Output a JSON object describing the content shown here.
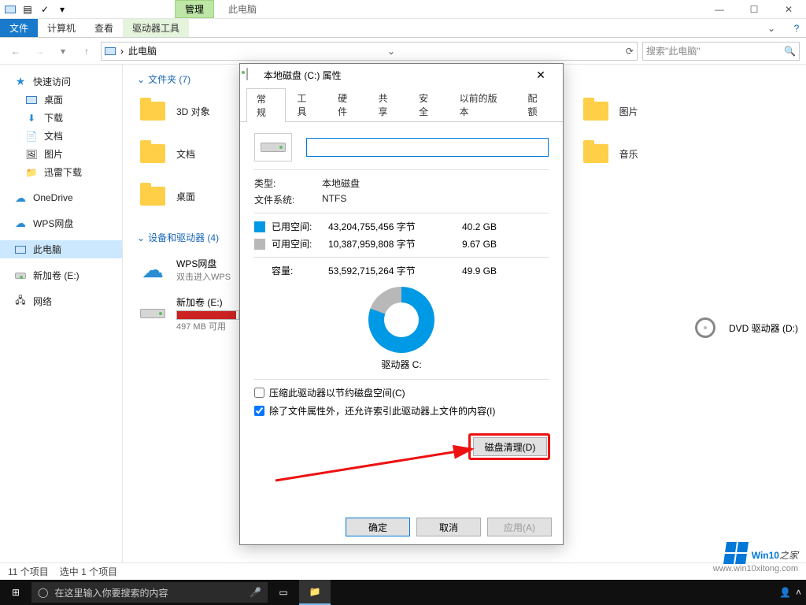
{
  "titlebar": {
    "context_tab": "管理",
    "title": "此电脑"
  },
  "ribbon": {
    "file": "文件",
    "tabs": [
      "计算机",
      "查看",
      "驱动器工具"
    ]
  },
  "address": {
    "crumb": "此电脑",
    "search_placeholder": "搜索\"此电脑\""
  },
  "sidebar": {
    "items": [
      {
        "label": "快速访问",
        "ico": "star"
      },
      {
        "label": "桌面",
        "ico": "monitor",
        "indent": true
      },
      {
        "label": "下载",
        "ico": "down",
        "indent": true
      },
      {
        "label": "文档",
        "ico": "doc",
        "indent": true
      },
      {
        "label": "图片",
        "ico": "pic",
        "indent": true
      },
      {
        "label": "迅雷下载",
        "ico": "folder",
        "indent": true
      },
      {
        "label": "OneDrive",
        "ico": "cloud"
      },
      {
        "label": "WPS网盘",
        "ico": "cloud"
      },
      {
        "label": "此电脑",
        "ico": "monitor",
        "selected": true
      },
      {
        "label": "新加卷 (E:)",
        "ico": "drive",
        "indent": true
      },
      {
        "label": "网络",
        "ico": "net"
      }
    ]
  },
  "content": {
    "folders_header": "文件夹 (7)",
    "folders": [
      "3D 对象",
      "图片",
      "文档",
      "音乐",
      "桌面"
    ],
    "devices_header": "设备和驱动器 (4)",
    "wps": {
      "name": "WPS网盘",
      "sub": "双击进入WPS"
    },
    "volE": {
      "name": "新加卷 (E:)",
      "sub": "497 MB 可用"
    },
    "dvd": {
      "name": "DVD 驱动器 (D:)"
    }
  },
  "dialog": {
    "title": "本地磁盘 (C:) 属性",
    "tabs": [
      "常规",
      "工具",
      "硬件",
      "共享",
      "安全",
      "以前的版本",
      "配额"
    ],
    "type_k": "类型:",
    "type_v": "本地磁盘",
    "fs_k": "文件系统:",
    "fs_v": "NTFS",
    "used_lbl": "已用空间:",
    "used_bytes": "43,204,755,456 字节",
    "used_gb": "40.2 GB",
    "free_lbl": "可用空间:",
    "free_bytes": "10,387,959,808 字节",
    "free_gb": "9.67 GB",
    "cap_lbl": "容量:",
    "cap_bytes": "53,592,715,264 字节",
    "cap_gb": "49.9 GB",
    "drive_label": "驱动器 C:",
    "cleanup": "磁盘清理(D)",
    "chk1": "压缩此驱动器以节约磁盘空间(C)",
    "chk2": "除了文件属性外，还允许索引此驱动器上文件的内容(I)",
    "ok": "确定",
    "cancel": "取消",
    "apply": "应用(A)"
  },
  "status": {
    "count": "11 个项目",
    "sel": "选中 1 个项目"
  },
  "taskbar": {
    "search_placeholder": "在这里输入你要搜索的内容"
  },
  "watermark": {
    "brand_a": "Win10",
    "brand_b": "之家",
    "url": "www.win10xitong.com"
  }
}
